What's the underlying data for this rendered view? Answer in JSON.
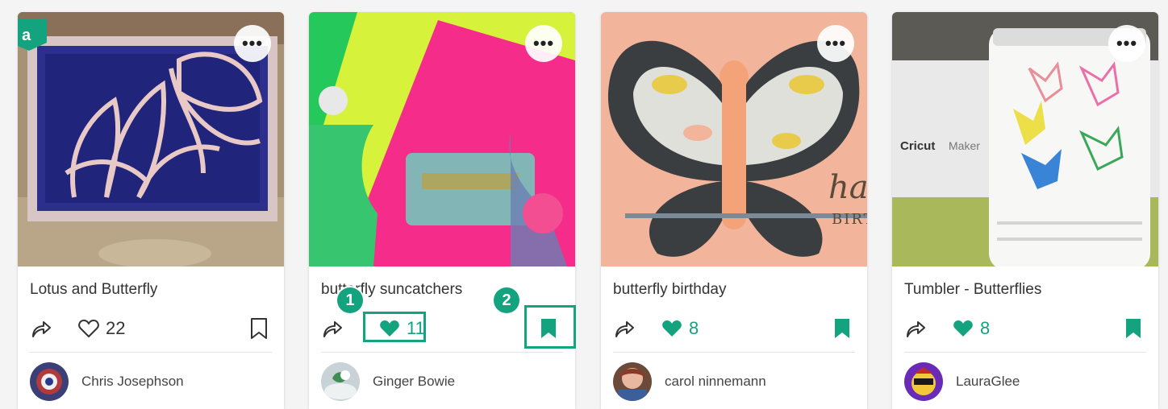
{
  "accent_color": "#14a37f",
  "cards": [
    {
      "title": "Lotus and Butterfly",
      "likes": "22",
      "liked": false,
      "saved": false,
      "author": "Chris Josephson",
      "badge": "a",
      "more": "•••"
    },
    {
      "title": "butterfly suncatchers",
      "likes": "11",
      "liked": true,
      "saved": true,
      "author": "Ginger Bowie",
      "more": "•••"
    },
    {
      "title": "butterfly birthday",
      "likes": "8",
      "liked": true,
      "saved": true,
      "author": "carol ninnemann",
      "more": "•••"
    },
    {
      "title": "Tumbler - Butterflies",
      "likes": "8",
      "liked": true,
      "saved": true,
      "author": "LauraGlee",
      "more": "•••"
    }
  ],
  "photo_text": {
    "birthday_card": [
      "happy",
      "BIRTH"
    ],
    "brand": "Cricut",
    "model": "Maker"
  },
  "callouts": [
    "1",
    "2"
  ]
}
